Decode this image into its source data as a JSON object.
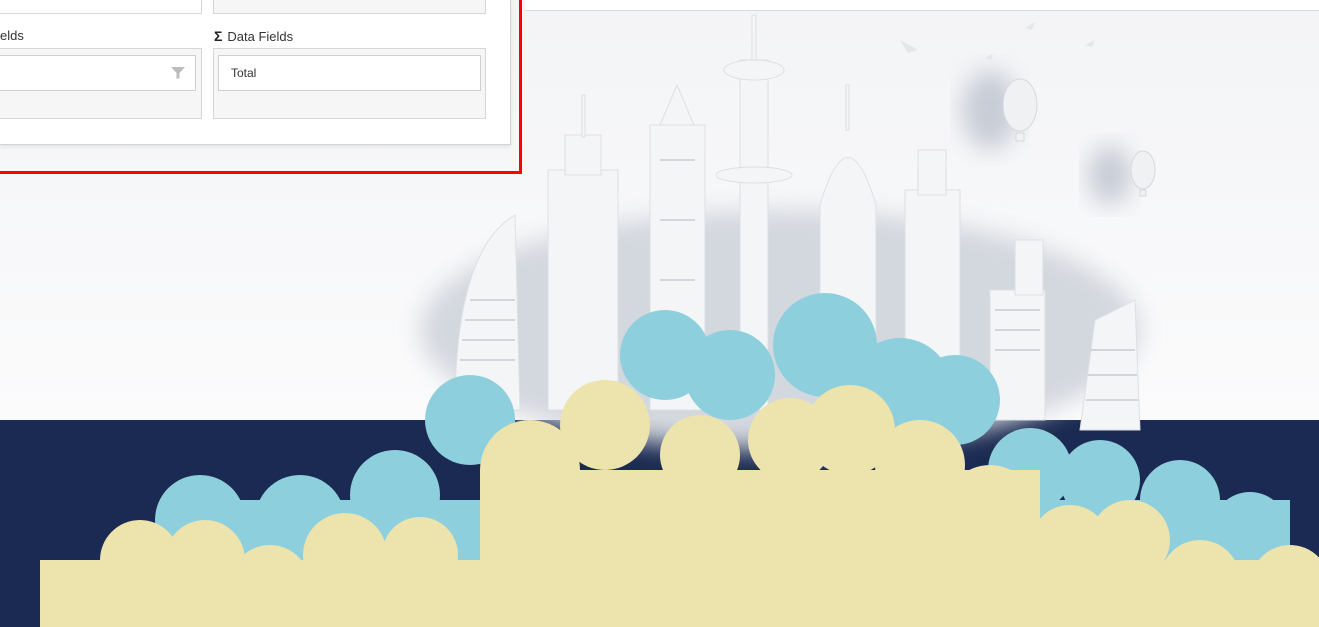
{
  "window": {
    "topbar_visible": true
  },
  "pivot_panel": {
    "filter_fields_label": "elds",
    "data_fields_label": "Data Fields",
    "data_fields_icon": "sigma-icon",
    "filter_chip_text": "",
    "filter_chip_icon": "funnel-icon",
    "data_chip_text": "Total"
  },
  "colors": {
    "highlight": "#ff0000",
    "navy_band": "#1b2a52",
    "cloud_blue": "#8dcfdc",
    "cloud_yellow": "#ece3ad"
  }
}
